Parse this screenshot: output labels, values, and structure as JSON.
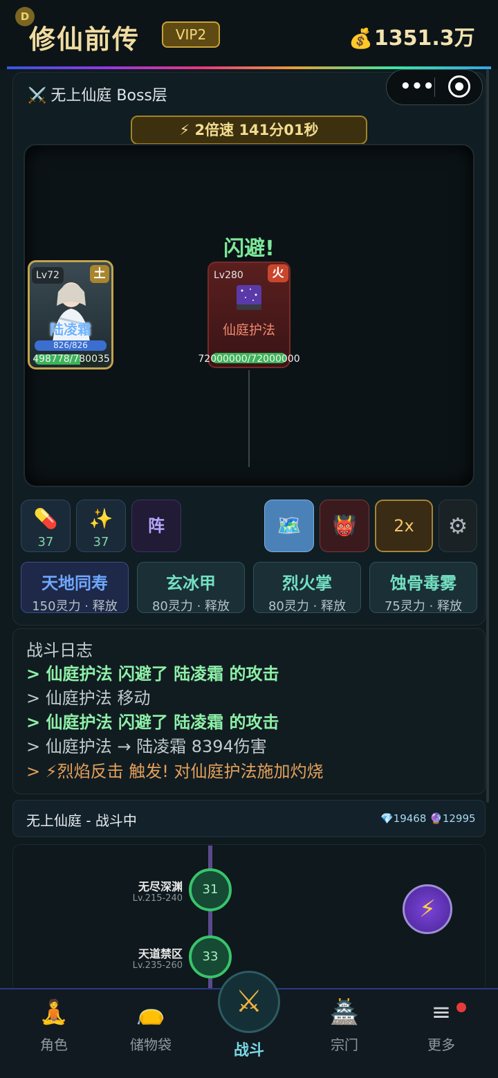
{
  "header": {
    "avatar_letter": "D",
    "title": "修仙前传",
    "vip": "VIP2",
    "coin_value": "1351.3万"
  },
  "capsule": {
    "more": "•••"
  },
  "battle": {
    "floor_title": "无上仙庭 Boss层",
    "speed_banner": "⚡ 2倍速 141分01秒",
    "dodge_text": "闪避!",
    "hero": {
      "level": "Lv72",
      "element": "土",
      "name": "陆凌霜",
      "mp": "826/826",
      "hp": "498778/780035",
      "hp_fraction": 0.639
    },
    "enemy": {
      "level": "Lv280",
      "element": "火",
      "name": "仙庭护法",
      "hp": "72000000/72000000"
    }
  },
  "actions": {
    "pill_count": "37",
    "spark_count": "37",
    "array_label": "阵",
    "speed_label": "2x"
  },
  "skills": [
    {
      "name": "天地同寿",
      "cost": "150灵力 · 释放"
    },
    {
      "name": "玄冰甲",
      "cost": "80灵力 · 释放"
    },
    {
      "name": "烈火掌",
      "cost": "80灵力 · 释放"
    },
    {
      "name": "蚀骨毒雾",
      "cost": "75灵力 · 释放"
    }
  ],
  "log": {
    "title": "战斗日志",
    "lines": [
      "> 仙庭护法 闪避了 陆凌霜 的攻击",
      "> 仙庭护法 移动",
      "> 仙庭护法 闪避了 陆凌霜 的攻击",
      "> 仙庭护法 → 陆凌霜 8394伤害",
      "> ⚡烈焰反击 触发! 对仙庭护法施加灼烧"
    ]
  },
  "status": {
    "text": "无上仙庭 - 战斗中",
    "currency": "💎19468 🔮12995"
  },
  "map": {
    "zones": [
      {
        "name": "无尽深渊",
        "range": "Lv.215-240",
        "node": "31"
      },
      {
        "name": "天道禁区",
        "range": "Lv.235-260",
        "node": "33"
      }
    ]
  },
  "nav": {
    "role": "角色",
    "bag": "储物袋",
    "battle": "战斗",
    "sect": "宗门",
    "more": "更多"
  }
}
